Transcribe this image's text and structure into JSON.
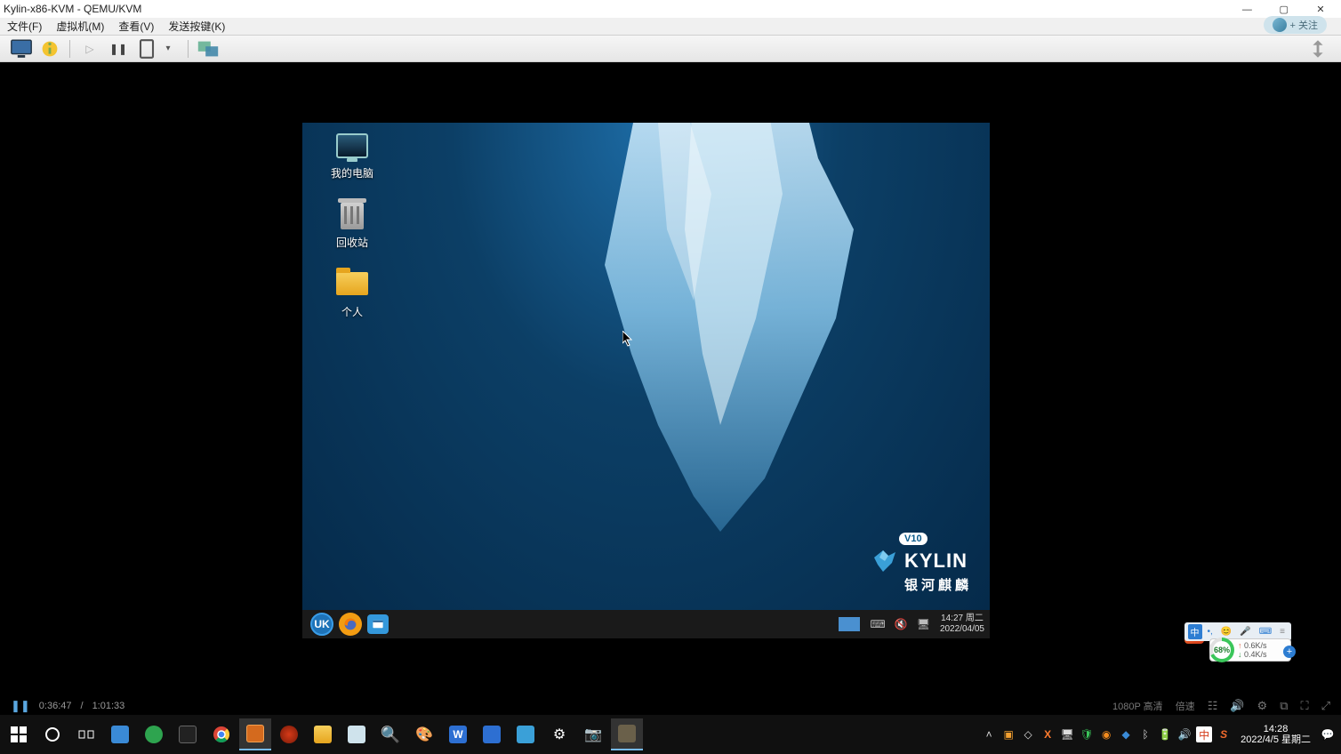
{
  "window": {
    "title": "Kylin-x86-KVM - QEMU/KVM"
  },
  "menubar": {
    "file": "文件(F)",
    "vm": "虚拟机(M)",
    "view": "查看(V)",
    "sendkey": "发送按键(K)",
    "follow": "+ 关注"
  },
  "guest": {
    "desktop_icons": {
      "computer": "我的电脑",
      "trash": "回收站",
      "personal": "个人"
    },
    "brand": {
      "version": "V10",
      "name": "KYLIN",
      "sub": "银河麒麟"
    },
    "taskbar": {
      "time": "14:27",
      "weekday": "周二",
      "date": "2022/04/05"
    }
  },
  "ime": {
    "lang": "中"
  },
  "netmon": {
    "percent": "68%",
    "up": "0.6K/s",
    "down": "0.4K/s"
  },
  "sogou": {
    "letter": "S"
  },
  "player": {
    "elapsed": "0:36:47",
    "total": "1:01:33",
    "quality": "1080P 高清",
    "speed": "倍速"
  },
  "host_tray": {
    "ime": "中",
    "sogou": "S",
    "time": "14:28",
    "date": "2022/4/5 星期二"
  }
}
